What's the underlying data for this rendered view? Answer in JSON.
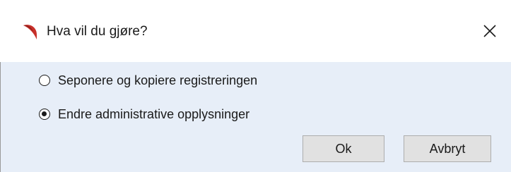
{
  "dialog": {
    "title": "Hva vil du gjøre?",
    "app_icon": "app-logo-icon",
    "close_icon": "close-icon"
  },
  "options": [
    {
      "label": "Seponere og kopiere registreringen",
      "checked": false
    },
    {
      "label": "Endre administrative opplysninger",
      "checked": true
    }
  ],
  "buttons": {
    "ok_label": "Ok",
    "cancel_label": "Avbryt"
  },
  "colors": {
    "panel_background": "#e7eef8",
    "button_background": "#e1e1e1",
    "logo_red": "#c8302a"
  }
}
